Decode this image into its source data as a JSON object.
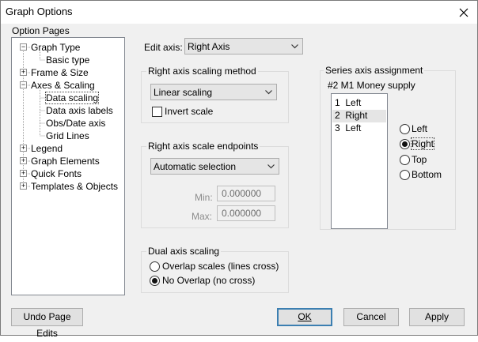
{
  "window": {
    "title": "Graph Options"
  },
  "tree": {
    "label": "Option Pages",
    "items": [
      {
        "label": "Graph Type",
        "expander": "minus"
      },
      {
        "label": "Basic type"
      },
      {
        "label": "Frame & Size",
        "expander": "plus"
      },
      {
        "label": "Axes & Scaling",
        "expander": "minus"
      },
      {
        "label": "Data scaling",
        "selected": true
      },
      {
        "label": "Data axis labels"
      },
      {
        "label": "Obs/Date axis"
      },
      {
        "label": "Grid Lines"
      },
      {
        "label": "Legend",
        "expander": "plus"
      },
      {
        "label": "Graph Elements",
        "expander": "plus"
      },
      {
        "label": "Quick Fonts",
        "expander": "plus"
      },
      {
        "label": "Templates & Objects",
        "expander": "plus"
      }
    ]
  },
  "edit_axis": {
    "label": "Edit axis:",
    "value": "Right Axis"
  },
  "scaling_method": {
    "label": "Right axis scaling method",
    "value": "Linear scaling",
    "invert_label": "Invert scale",
    "invert_checked": false
  },
  "endpoints": {
    "label": "Right axis scale endpoints",
    "value": "Automatic selection",
    "min_label": "Min:",
    "min_value": "0.000000",
    "max_label": "Max:",
    "max_value": "0.000000"
  },
  "dual": {
    "label": "Dual axis scaling",
    "overlap_label": "Overlap scales  (lines cross)",
    "no_overlap_label": "No Overlap (no cross)",
    "selected": "no_overlap"
  },
  "series": {
    "label": "Series axis assignment",
    "current": "#2  M1 Money supply",
    "list": [
      {
        "num": "1",
        "axis": "Left"
      },
      {
        "num": "2",
        "axis": "Right",
        "selected": true
      },
      {
        "num": "3",
        "axis": "Left"
      }
    ],
    "options": [
      "Left",
      "Right",
      "Top",
      "Bottom"
    ],
    "selected_option": "Right"
  },
  "buttons": {
    "undo": "Undo Page Edits",
    "ok": "OK",
    "cancel": "Cancel",
    "apply": "Apply"
  }
}
